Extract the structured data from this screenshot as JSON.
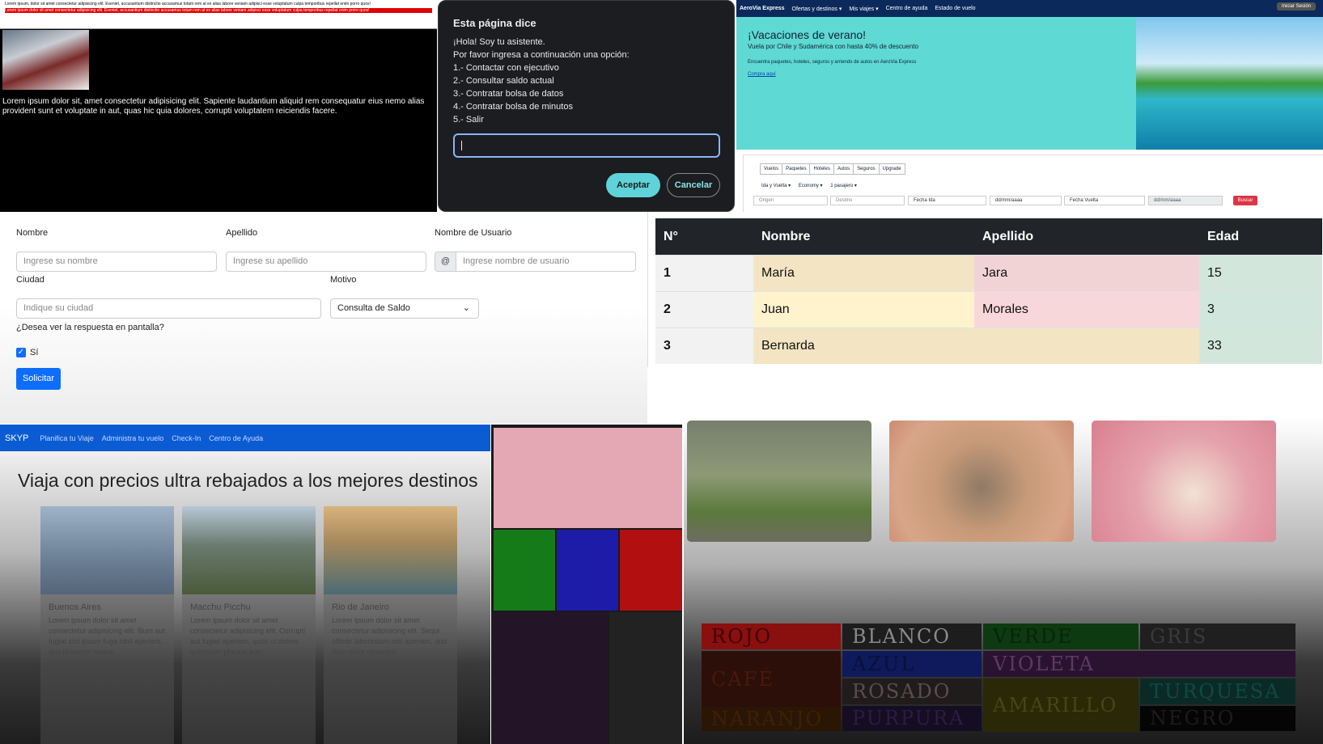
{
  "panel1": {
    "top_text": "Lorem ipsum, dolor sit amet consectetur adipisicing elit. Eveniet, accusantium distinctio accusamus totam rem at ex alias labore veniam adipisci esse voluptatum culpa temporibus repellat enim porro quos!",
    "red_text": "Lorem ipsum dolor sit amet consectetur adipisicing elit. Eveniet, accusantium distinctio accusamus totam rem at ex alias labore veniam adipisci esse voluptatum culpa temporibus repellat enim porro quos!",
    "paragraph": "Lorem ipsum dolor sit, amet consectetur adipisicing elit. Sapiente laudantium aliquid rem consequatur eius nemo alias provident sunt et voluptate in aut, quas hic quia dolores, corrupti voluptatem reiciendis facere."
  },
  "dialog": {
    "title": "Esta página dice",
    "lines": [
      "¡Hola! Soy tu asistente.",
      "Por favor ingresa a continuación una opción:",
      "1.- Contactar con ejecutivo",
      "2.- Consultar saldo actual",
      "3.- Contratar bolsa de datos",
      "4.- Contratar bolsa de minutos",
      "5.- Salir"
    ],
    "ok": "Aceptar",
    "cancel": "Cancelar"
  },
  "aerovia": {
    "brand": "AeroVia Express",
    "nav": [
      "Ofertas y destinos ▾",
      "Mis viajes ▾",
      "Centro de ayuda",
      "Estado de vuelo"
    ],
    "login": "Iniciar Sesión",
    "hero_title": "¡Vacaciones de verano!",
    "hero_sub": "Vuela por Chile y Sudamérica con hasta 40% de descuento",
    "hero_text": "Encuentra paquetes, hoteles, seguros y arriendo de autos en AeroVia Express",
    "hero_link": "Compra aquí",
    "tabs": [
      "Vuelos",
      "Paquetes",
      "Hoteles",
      "Autos",
      "Seguros",
      "Upgrade"
    ],
    "options": [
      "Ida y Vuelta ▾",
      "Economy ▾",
      "1 pasajero ▾"
    ],
    "fields": [
      "Origen",
      "Destino",
      "Fecha Ida",
      "dd/mm/aaaa",
      "Fecha Vuelta",
      "dd/mm/aaaa"
    ],
    "search": "Buscar"
  },
  "form": {
    "nombre_label": "Nombre",
    "nombre_ph": "Ingrese su nombre",
    "apellido_label": "Apellido",
    "apellido_ph": "Ingrese su apellido",
    "usuario_label": "Nombre de Usuario",
    "usuario_prefix": "@",
    "usuario_ph": "Ingrese nombre de usuario",
    "ciudad_label": "Ciudad",
    "ciudad_ph": "Indique su ciudad",
    "motivo_label": "Motivo",
    "motivo_value": "Consulta de Saldo",
    "question": "¿Desea ver la respuesta en pantalla?",
    "check_label": "Sí",
    "submit": "Solicitar"
  },
  "table": {
    "headers": [
      "N°",
      "Nombre",
      "Apellido",
      "Edad"
    ],
    "rows": [
      [
        "1",
        "María",
        "Jara",
        "15"
      ],
      [
        "2",
        "Juan",
        "Morales",
        "3"
      ],
      [
        "3",
        "Bernarda",
        "",
        "33"
      ]
    ],
    "colors": {
      "nombre1": "#f3e5c3",
      "apellido1": "#f1d3d6",
      "edad1": "#d2e6dc",
      "nombre2": "#fff3cd",
      "apellido2": "#f8d7da",
      "edad2": "#d1e7dd",
      "nombre3": "#f3e5c3",
      "edad3": "#d2e6dc"
    }
  },
  "skyp": {
    "brand": "SKYP",
    "nav": [
      "Planifica tu Viaje",
      "Administra tu vuelo",
      "Check-In",
      "Centro de Ayuda"
    ],
    "headline": "Viaja con precios ultra rebajados a los mejores destinos",
    "cards": [
      {
        "title": "Buenos Aires",
        "text": "Lorem ipsum dolor sit amet consectetur adipisicing elit. Illum aut fugiat sint ipsam fuga nihil aperiam, quo id earum neque."
      },
      {
        "title": "Macchu Picchu",
        "text": "Lorem ipsum dolor sit amet consectetur adipisicing elit. Corrupti aut fugiat aperiam, quos ut dolore quisquam placeat eum."
      },
      {
        "title": "Rio de Janeiro",
        "text": "Lorem ipsum dolor sit amet consectetur adipisicing elit. Sequi officiis laboriosam nisi aperiam, quo illum dolor deserunt."
      }
    ]
  },
  "colors": {
    "words": [
      "ROJO",
      "BLANCO",
      "VERDE",
      "GRIS",
      "CAFÉ",
      "AZUL",
      "VIOLETA",
      "ROSADO",
      "AMARILLO",
      "TURQUESA",
      "NARANJO",
      "PURPURA",
      "NEGRO"
    ]
  }
}
